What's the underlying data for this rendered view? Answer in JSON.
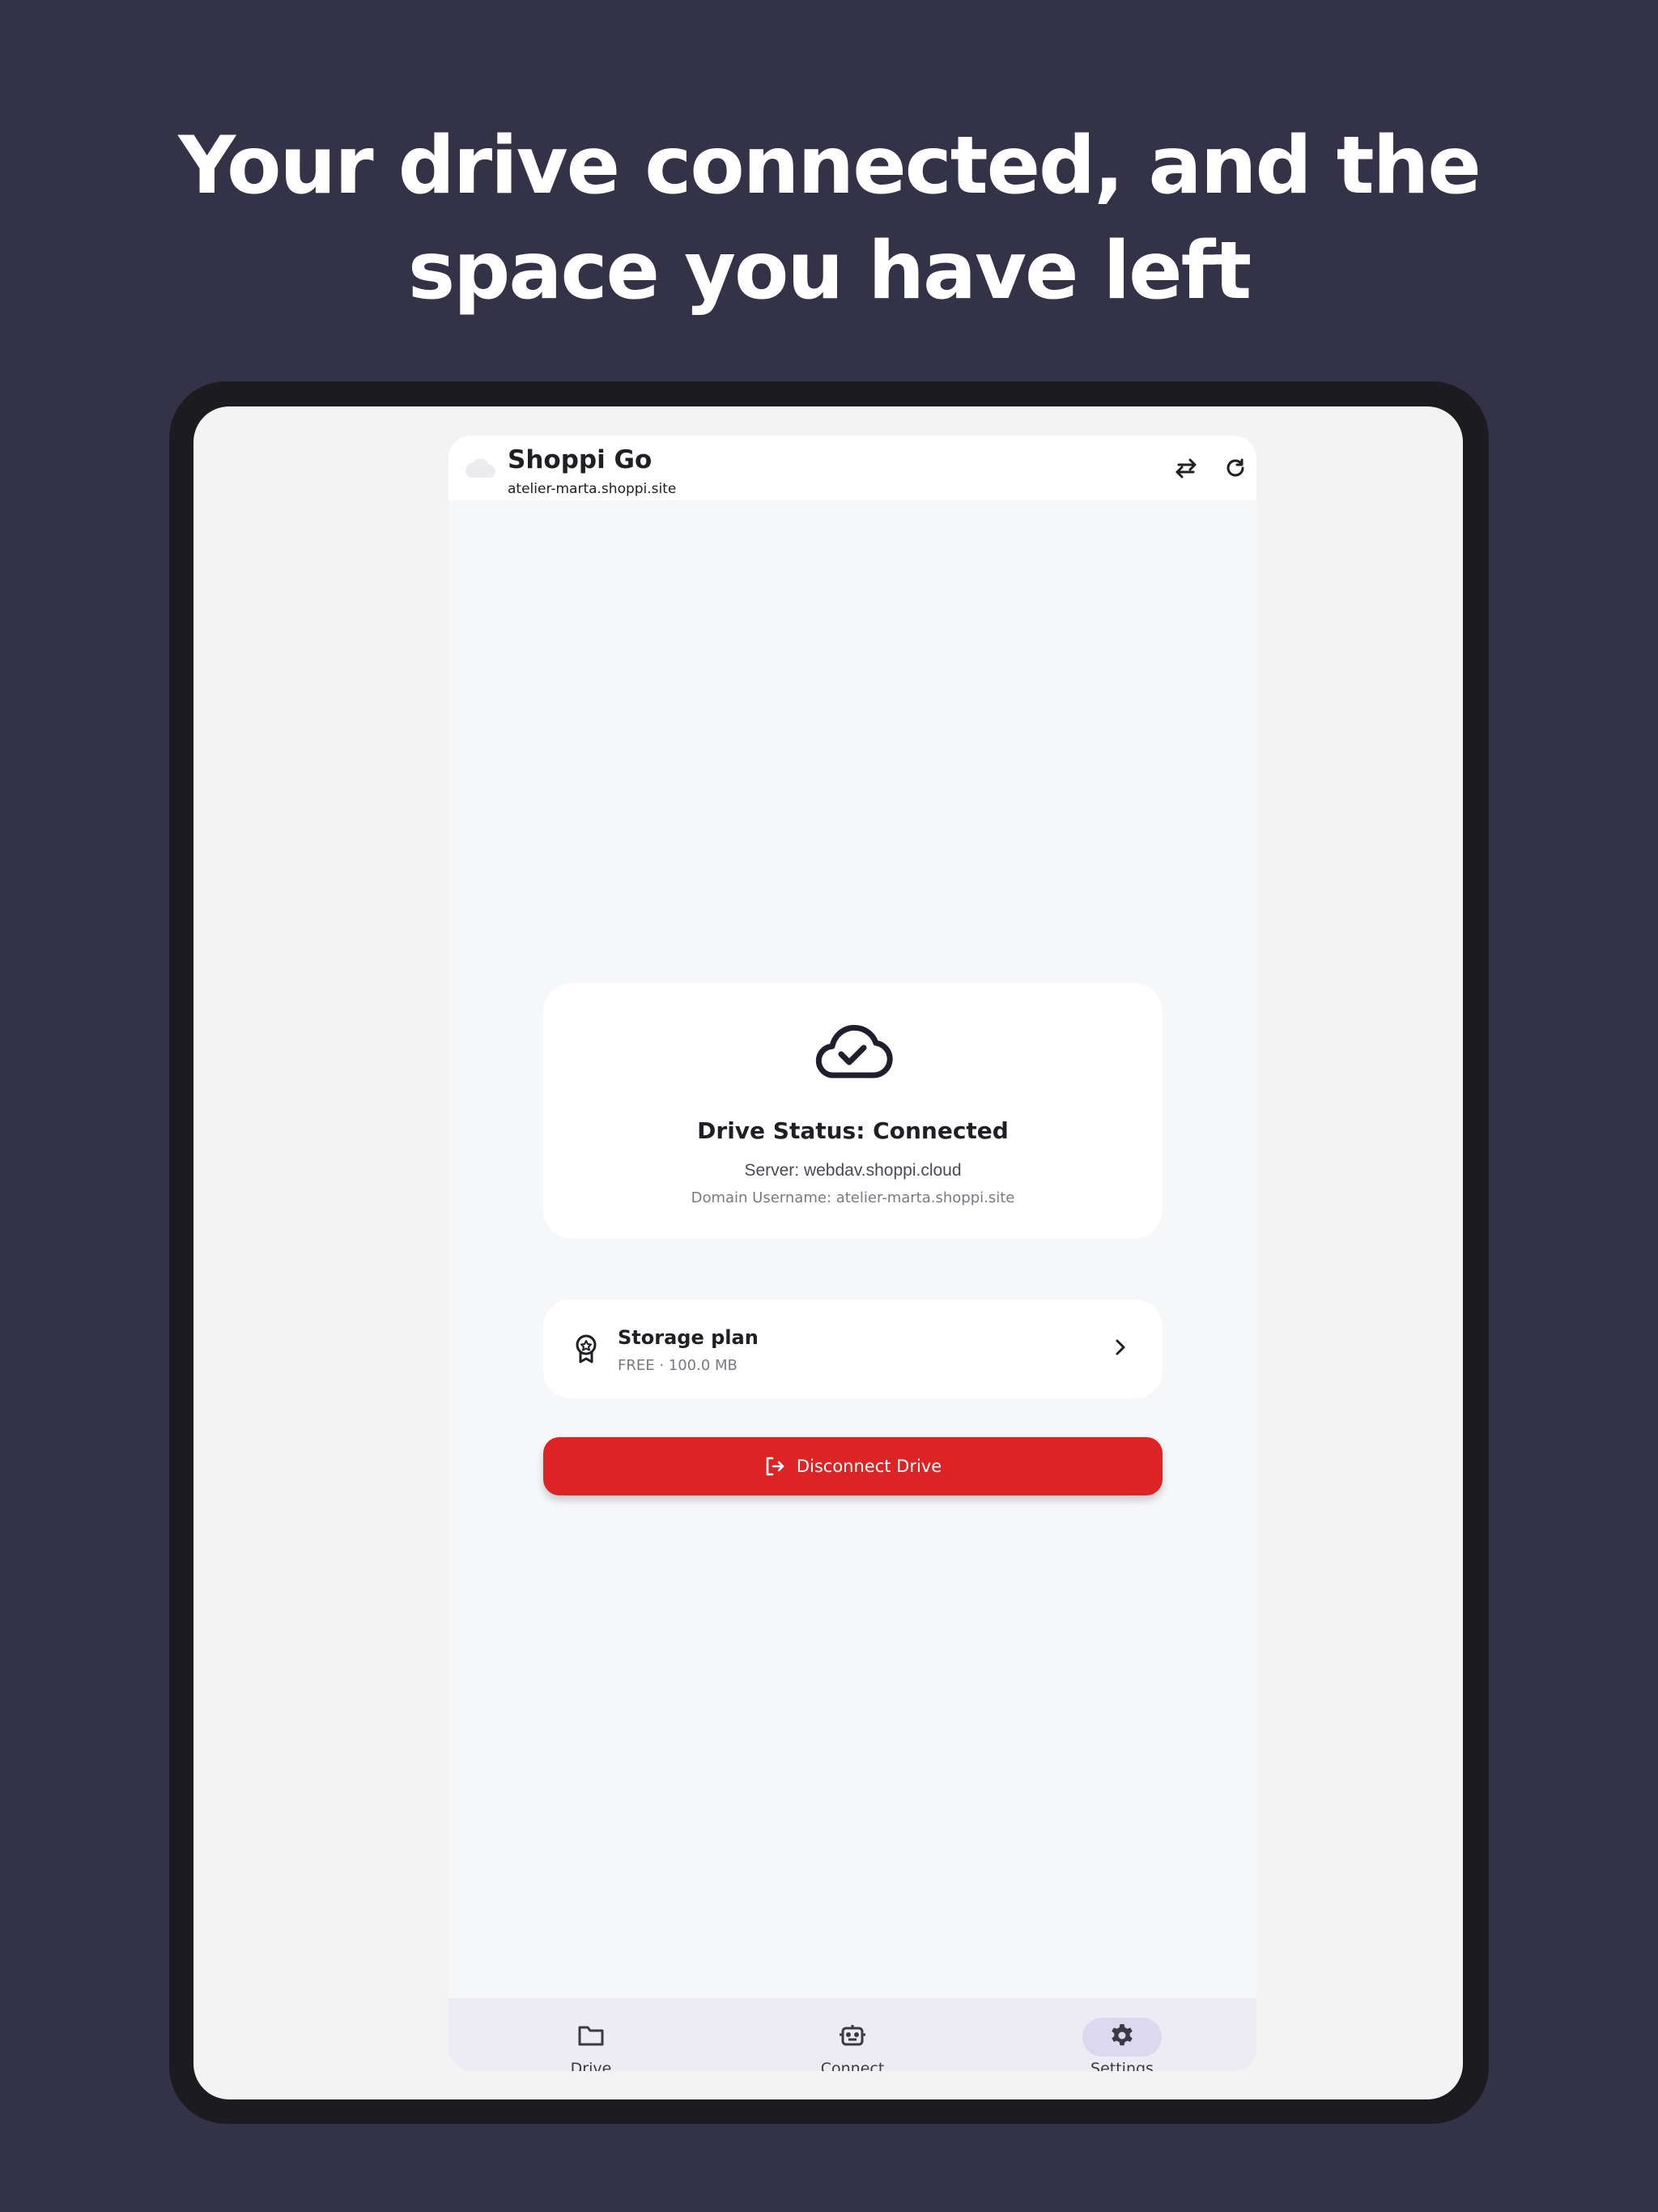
{
  "marketing": {
    "headline": "Your drive connected, and the space you have left"
  },
  "header": {
    "title": "Shoppi Go",
    "subtitle": "atelier-marta.shoppi.site",
    "icons": [
      "cloud-icon",
      "swap-icon",
      "refresh-icon"
    ]
  },
  "status_card": {
    "title": "Drive Status: Connected",
    "server": "Server: webdav.shoppi.cloud",
    "username": "Domain Username: atelier-marta.shoppi.site",
    "icon": "cloud-check-icon"
  },
  "plan_card": {
    "title": "Storage plan",
    "subtitle": "FREE · 100.0 MB",
    "icon": "badge-icon"
  },
  "disconnect": {
    "label": "Disconnect Drive",
    "color": "#dc2426"
  },
  "nav": {
    "items": [
      {
        "label": "Drive",
        "icon": "folder-icon"
      },
      {
        "label": "Connect",
        "icon": "robot-icon"
      },
      {
        "label": "Settings",
        "icon": "gear-icon"
      }
    ],
    "active": "Settings"
  },
  "colors": {
    "background": "#343247",
    "accent_active": "#dcd9ef"
  }
}
